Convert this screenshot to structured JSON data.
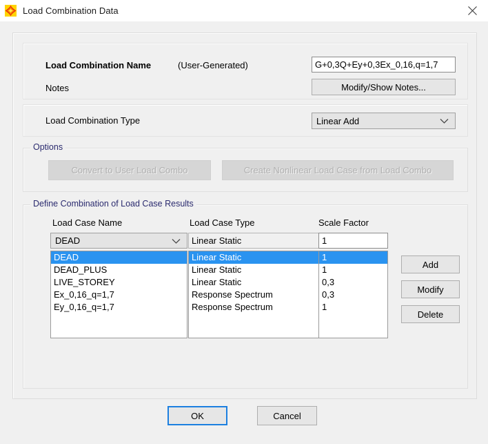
{
  "window": {
    "title": "Load Combination Data",
    "icon": "app-star-icon",
    "close_icon": "close-icon"
  },
  "name_section": {
    "label": "Load Combination Name",
    "origin_label": "(User-Generated)",
    "value": "G+0,3Q+Ey+0,3Ex_0,16,q=1,7",
    "notes_label": "Notes",
    "notes_button": "Modify/Show Notes..."
  },
  "type_section": {
    "label": "Load Combination Type",
    "value": "Linear Add",
    "chevron_icon": "chevron-down-icon"
  },
  "options": {
    "caption": "Options",
    "convert_button": "Convert to User Load Combo",
    "create_button": "Create Nonlinear Load Case from Load Combo"
  },
  "define": {
    "caption": "Define Combination of Load Case Results",
    "headers": {
      "name": "Load Case Name",
      "type": "Load Case Type",
      "scale": "Scale Factor"
    },
    "editor": {
      "case_name": "DEAD",
      "case_type": "Linear Static",
      "scale_factor": "1",
      "chevron_icon": "chevron-down-icon"
    },
    "rows": [
      {
        "name": "DEAD",
        "type": "Linear Static",
        "scale": "1",
        "selected": true
      },
      {
        "name": "DEAD_PLUS",
        "type": "Linear Static",
        "scale": "1",
        "selected": false
      },
      {
        "name": "LIVE_STOREY",
        "type": "Linear Static",
        "scale": "0,3",
        "selected": false
      },
      {
        "name": "Ex_0,16_q=1,7",
        "type": "Response Spectrum",
        "scale": "0,3",
        "selected": false
      },
      {
        "name": "Ey_0,16_q=1,7",
        "type": "Response Spectrum",
        "scale": "1",
        "selected": false
      }
    ],
    "actions": {
      "add": "Add",
      "modify": "Modify",
      "delete": "Delete"
    }
  },
  "footer": {
    "ok": "OK",
    "cancel": "Cancel"
  },
  "colors": {
    "selection": "#2a93f0",
    "group_caption": "#2a2a6e",
    "focus_border": "#1b7fe0",
    "dialog_bg": "#f0f0f0"
  }
}
